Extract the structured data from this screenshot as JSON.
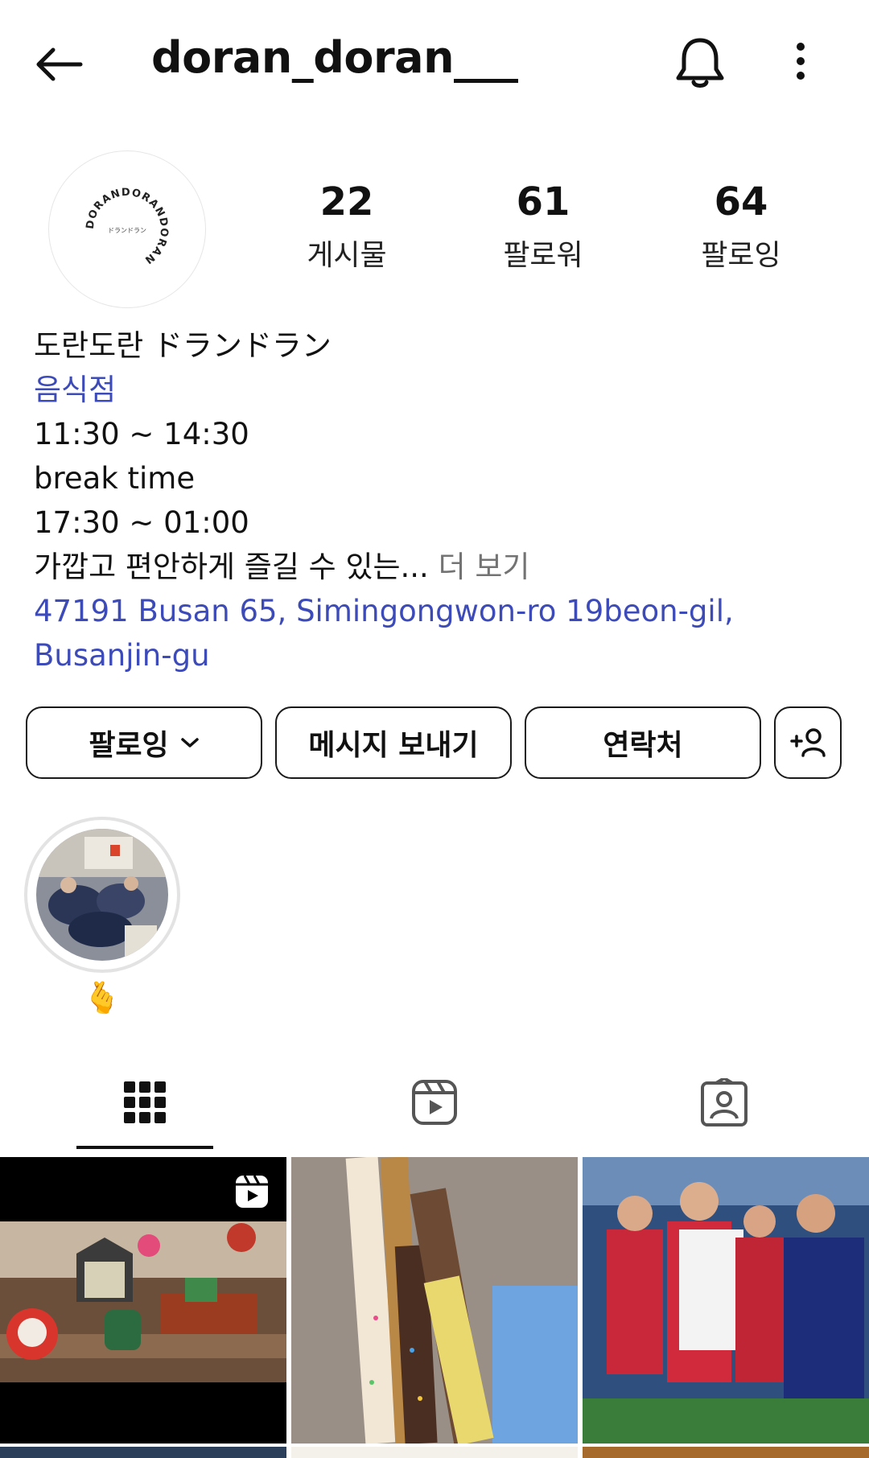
{
  "header": {
    "username": "doran_doran___"
  },
  "stats": [
    {
      "value": "22",
      "label": "게시물"
    },
    {
      "value": "61",
      "label": "팔로워"
    },
    {
      "value": "64",
      "label": "팔로잉"
    }
  ],
  "bio": {
    "name": "도란도란 ドランドラン",
    "category": "음식점",
    "line1": "11:30 ~ 14:30",
    "line2": "break time",
    "line3": "17:30 ~ 01:00",
    "description": "가깝고 편안하게 즐길 수 있는...",
    "more": " 더 보기",
    "address_line1": "47191 Busan 65, Simingongwon-ro 19beon-gil,",
    "address_line2": "Busanjin-gu"
  },
  "avatar": {
    "logo_text": "DORANDORANDORAN",
    "logo_inner": "ドランドラン"
  },
  "buttons": {
    "following": "팔로잉",
    "message": "메시지 보내기",
    "contact": "연락처"
  },
  "highlight": {
    "label": "🫰"
  },
  "icons": {
    "back": "arrow-left-icon",
    "notifications": "bell-icon",
    "more": "more-vertical-icon",
    "add_person": "add-person-icon",
    "grid_tab": "grid-icon",
    "reels_tab": "reels-icon",
    "tagged_tab": "tagged-person-icon"
  },
  "colors": {
    "link": "#3d4bb8",
    "muted": "#737373",
    "text": "#111111"
  }
}
